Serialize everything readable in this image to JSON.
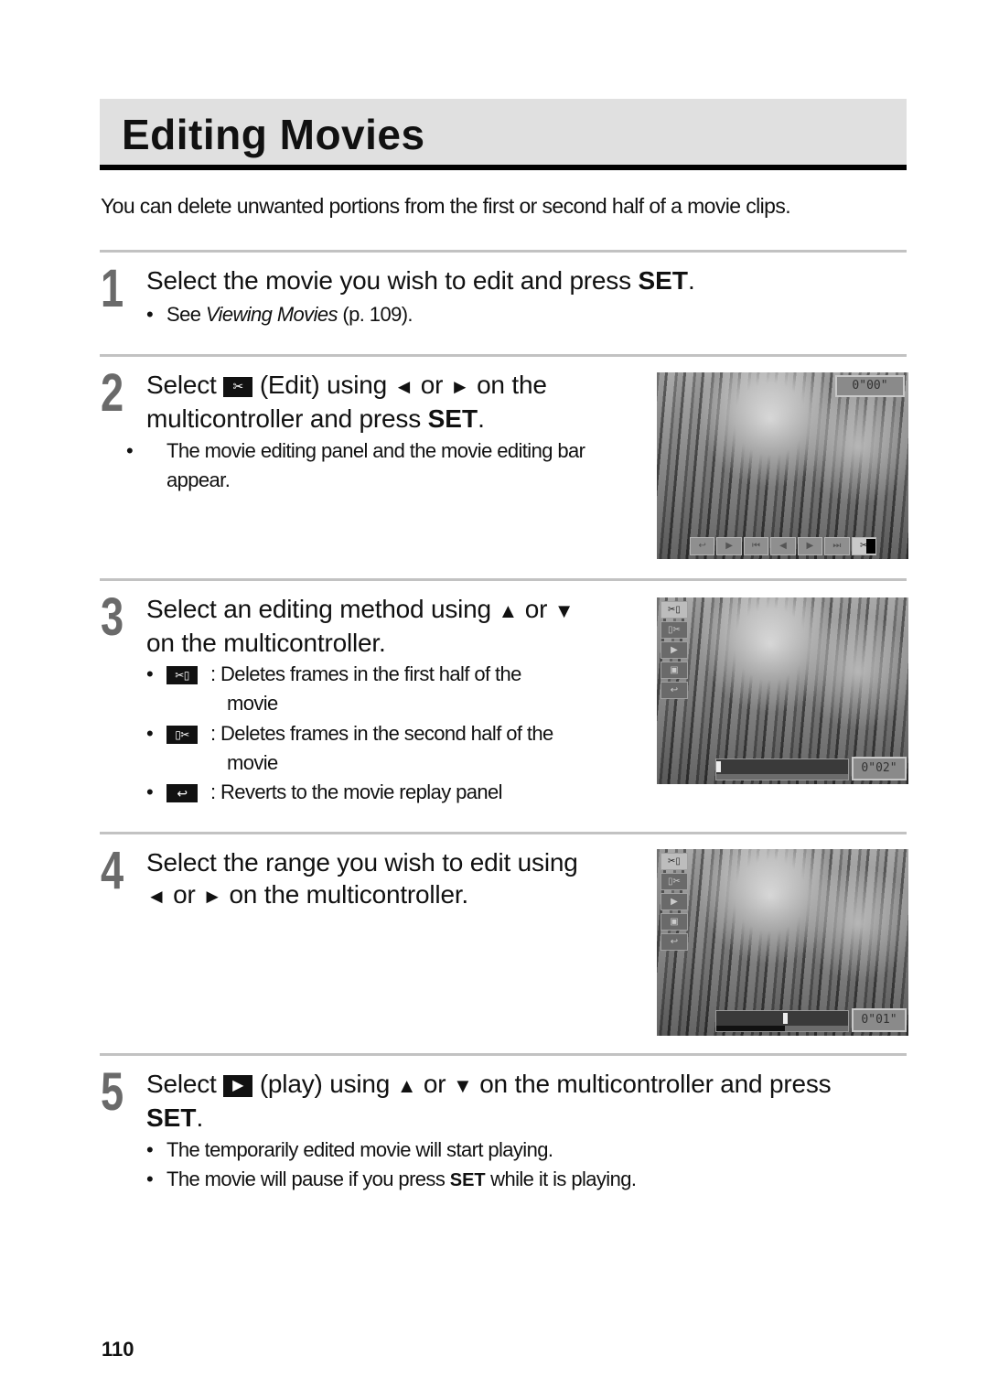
{
  "page": {
    "title": "Editing Movies",
    "intro": "You can delete unwanted portions from the first or second half of a movie clips.",
    "page_number": "110"
  },
  "steps": [
    {
      "number": "1",
      "heading": {
        "pre": "Select the movie you wish to edit and press ",
        "set": "SET",
        "post": "."
      },
      "bullets": [
        {
          "pre": "See ",
          "italic": "Viewing Movies",
          "post": " (p. 109)."
        }
      ]
    },
    {
      "number": "2",
      "heading": {
        "select": "Select",
        "icon": "scissors-icon",
        "edit": "(Edit) using",
        "left": "◄",
        "or": "or",
        "right": "►",
        "on_the": "on the",
        "line2": "multicontroller and press ",
        "set": "SET",
        "post": "."
      },
      "bullets": [
        {
          "text": "The movie editing panel and the movie editing bar appear."
        }
      ],
      "screenshot": {
        "counter": "0\"00\"",
        "toolbar": [
          "back",
          "play",
          "first",
          "prev",
          "next",
          "last",
          "edit"
        ],
        "active": "edit"
      }
    },
    {
      "number": "3",
      "heading": {
        "line1": "Select an editing method using",
        "up": "▲",
        "or": "or",
        "down": "▼",
        "line2": "on the multicontroller."
      },
      "bullets": [
        {
          "icon": "cut-first-half-icon",
          "text": ": Deletes frames in the first half of the",
          "cont": "movie"
        },
        {
          "icon": "cut-second-half-icon",
          "text": ": Deletes frames in the second half of the",
          "cont": "movie"
        },
        {
          "icon": "revert-icon",
          "text": ": Reverts to the movie replay panel"
        }
      ],
      "screenshot": {
        "counter": "0\"02\"",
        "active": "cut-first-half"
      }
    },
    {
      "number": "4",
      "heading": {
        "line1": "Select the range you wish to edit using",
        "left": "◄",
        "or": "or",
        "right": "►",
        "line2": "on the multicontroller."
      },
      "screenshot": {
        "counter": "0\"01\"",
        "active": "cut-first-half"
      }
    },
    {
      "number": "5",
      "heading": {
        "select": "Select",
        "icon": "play-icon",
        "mid": "(play) using",
        "up": "▲",
        "or": "or",
        "down": "▼",
        "post": "on the multicontroller and press",
        "set": "SET",
        "end": "."
      },
      "bullets": [
        {
          "text": "The temporarily edited movie will start playing."
        },
        {
          "pre": "The movie will pause if you press ",
          "set": "SET",
          "post": " while it is playing."
        }
      ]
    }
  ],
  "icons": {
    "scissors": "✂",
    "play": "▶",
    "revert": "↩",
    "cut_first": "✂▯",
    "cut_second": "▯✂",
    "bullet": "•"
  }
}
